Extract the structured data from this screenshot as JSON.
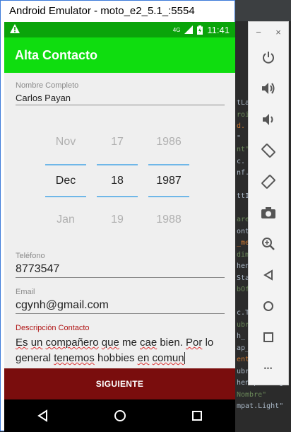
{
  "window": {
    "title": "Android Emulator - moto_e2_5.1_:5554"
  },
  "status_bar": {
    "time": "11:41",
    "network": "4G"
  },
  "app_bar": {
    "title": "Alta Contacto"
  },
  "form": {
    "name_label": "Nombre Completo",
    "name_value": "Carlos Payan",
    "date_picker": {
      "months": [
        "Nov",
        "Dec",
        "Jan"
      ],
      "days": [
        "17",
        "18",
        "19"
      ],
      "years": [
        "1986",
        "1987",
        "1988"
      ]
    },
    "phone_label": "Teléfono",
    "phone_value": "8773547",
    "email_label": "Email",
    "email_value": "cgynh@gmail.com",
    "desc_label": "Descripción Contacto",
    "desc_words": [
      "Es",
      "un",
      "compañero",
      "que",
      "me",
      "cae",
      "bien.",
      "Por",
      "lo",
      "general",
      "tenemos",
      "hobbies",
      "en",
      "comun"
    ]
  },
  "buttons": {
    "next_label": "SIGUIENTE"
  },
  "side_panel": {
    "minimize": "−",
    "close": "×",
    "more": "•••"
  },
  "ide_code": [
    "tLa",
    "roi",
    "d.",
    "\"",
    "nt\"",
    "c.",
    "nf.",
    "",
    "ttI",
    "",
    "are",
    "ont",
    "_me",
    "dim",
    "hen",
    "Sta",
    "bOf",
    "",
    "c.T",
    "ubr",
    "h_",
    "ap_",
    "ent",
    "ubr",
    "hen/padding",
    "Nombre\"",
    "mpat.Light\""
  ],
  "colors": {
    "status": "#0aa40a",
    "appbar": "#0fdd0f",
    "button": "#7a0d0d",
    "accent_line": "#6fb7e8",
    "error_label": "#b01515"
  }
}
